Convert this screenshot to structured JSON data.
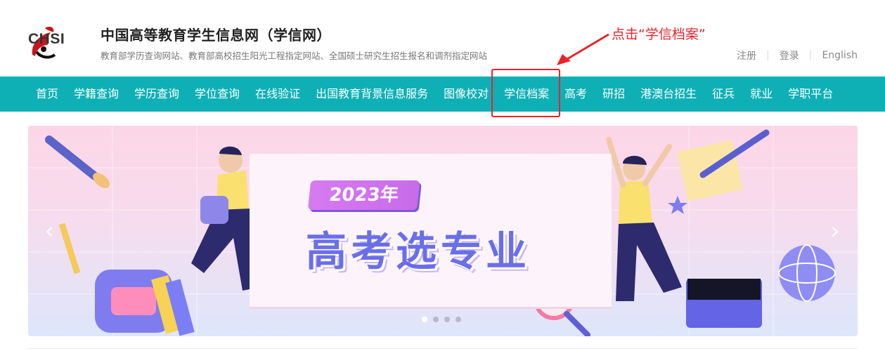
{
  "header": {
    "logo_text": "CHSI",
    "site_title": "中国高等教育学生信息网（学信网）",
    "site_subtitle": "教育部学历查询网站、教育部高校招生阳光工程指定网站、全国硕士研究生招生报名和调剂指定网站",
    "annotation": "点击“学信档案”",
    "links": [
      "注册",
      "登录",
      "English"
    ]
  },
  "nav": {
    "items": [
      "首页",
      "学籍查询",
      "学历查询",
      "学位查询",
      "在线验证",
      "出国教育背景信息服务",
      "图像校对",
      "学信档案",
      "高考",
      "研招",
      "港澳台招生",
      "征兵",
      "就业",
      "学职平台"
    ],
    "highlighted": "学信档案"
  },
  "banner": {
    "badge": "2023年",
    "headline": "高考选专业",
    "prev": "‹",
    "next": "›",
    "slide_count": 4,
    "active_slide": 1
  },
  "colors": {
    "nav_bg": "#0eb0b6",
    "highlight": "#e8242a",
    "headline": "#6a6fe8"
  }
}
